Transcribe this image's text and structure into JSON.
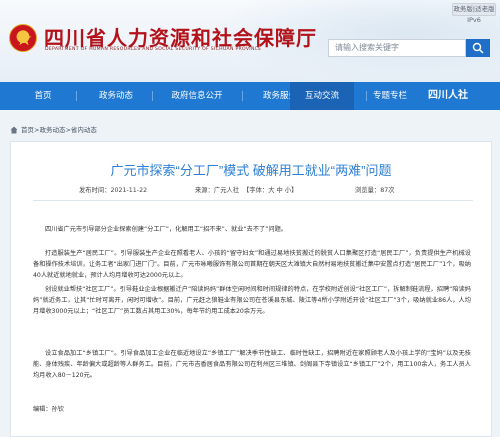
{
  "header": {
    "site_title": "四川省人力资源和社会保障厅",
    "site_subtitle": "DEPARTMENT OF HUMAN RESOURCES AND SOCIAL SECURITY OF SICHUAN PROVINCE",
    "version_link": "政务版|适老版IPv6",
    "search_placeholder": "请输入搜索关键字",
    "brand_color": "#b3121a",
    "nav_color": "#1f78d1"
  },
  "nav": {
    "items": [
      "首页",
      "政务动态",
      "政府信息公开",
      "政务服务",
      "互动交流",
      "专题专栏"
    ],
    "active_index": 4,
    "logo_text": "四川人社"
  },
  "breadcrumb": {
    "items": [
      "首页",
      "政务动态",
      "省内动态"
    ],
    "separator": ">"
  },
  "article": {
    "title": "广元市探索“分工厂”模式 破解用工就业“两难”问题",
    "published": "发布时间：2021-11-22",
    "source": "来源：广元人社",
    "font_size_label": "【字体：大 中 小】",
    "views": "浏览量：87次",
    "paragraphs": [
      "四川省广元市引导部分企业探索创建“分工厂”，化解用工“招不来”、就业“去不了”问题。",
      "打造服装生产“居民工厂”。引导服装生产企业在照看老人、小孩的“留守妇女”和通过易地扶贫搬迁的脱贫人口集聚区打造“居民工厂”，负责提供生产机械设备和操作技术培训，让务工者“出家门进厂门”。目前，广元市咏曦服饰有限公司首期在朝天区大滩镇大自然村易地扶贫搬迁集中安置点打造“居民工厂”1个，吸纳40人就近就地就业，预计人均月增收可达2000元以上。",
      "创设就业帮扶“社区工厂”。引导鞋业企业根据搬迁户“陪读妈妈”群体空闲时间和时间规律的特点，在学校附近创设“社区工厂”，拆解制鞋流程，招聘“陪读妈妈”就近务工，让其“忙时可离开，闲时可增收”。目前，广元赶之狼鞋业有限公司在苍溪县东城、陵江等4所小学附近开设“社区工厂”3个，吸纳就业86人，人均月增收3000元以上；“社区工厂”员工数占其用工30%，每年节约用工成本20余万元。",
      "设立食品加工“乡镇工厂”。引导食品加工企业在临近地设立“乡镇工厂”解决季节性缺工、临时性缺工，招聘附近在家照顾老人及小孩上学的“宝妈”以及无技能、身体残疾、年龄偏大或超龄等人群务工。目前，广元市吉香居食品有限公司在利州区三堆镇、剑阁县下寺镇设立“乡镇工厂”2个，用工100余人，务工人员人均月收入80－120元。"
    ],
    "editor": "编辑：孙钦"
  }
}
